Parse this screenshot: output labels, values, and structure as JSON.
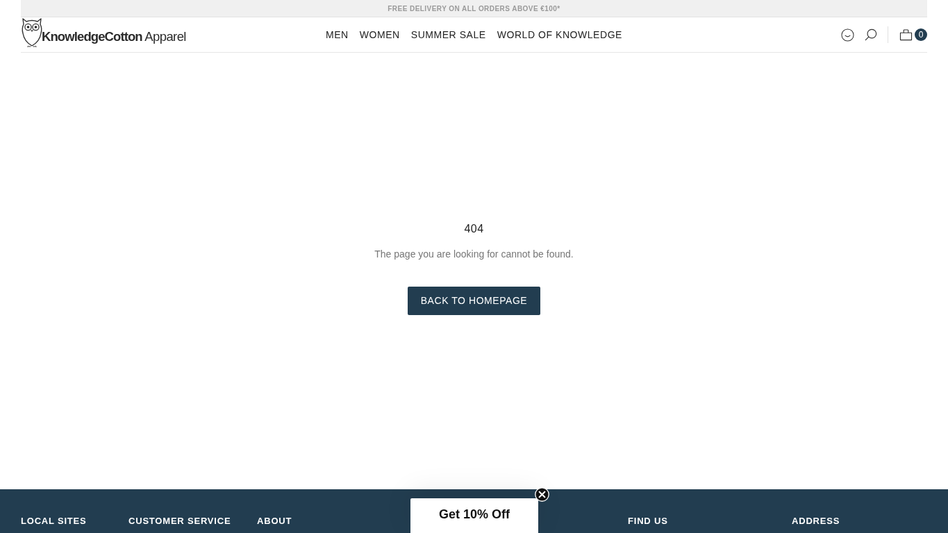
{
  "announcement_bar": {
    "text": "FREE DELIVERY ON ALL ORDERS ABOVE €100*"
  },
  "header": {
    "logo": "**KnowledgeCotton** Apparel",
    "nav": [
      "MEN",
      "WOMEN",
      "SUMMER SALE",
      "WORLD OF KNOWLEDGE"
    ],
    "cart_count": "0"
  },
  "error": {
    "code": "404",
    "message": "The page you are looking for cannot be found.",
    "button": "BACK TO HOMEPAGE"
  },
  "footer": {
    "columns": [
      {
        "heading": "LOCAL SITES"
      },
      {
        "heading": "CUSTOMER SERVICE"
      },
      {
        "heading": "ABOUT"
      },
      {
        "heading": "FIND US"
      },
      {
        "heading": "ADDRESS"
      }
    ]
  },
  "popup": {
    "label": "Get 10% Off"
  }
}
